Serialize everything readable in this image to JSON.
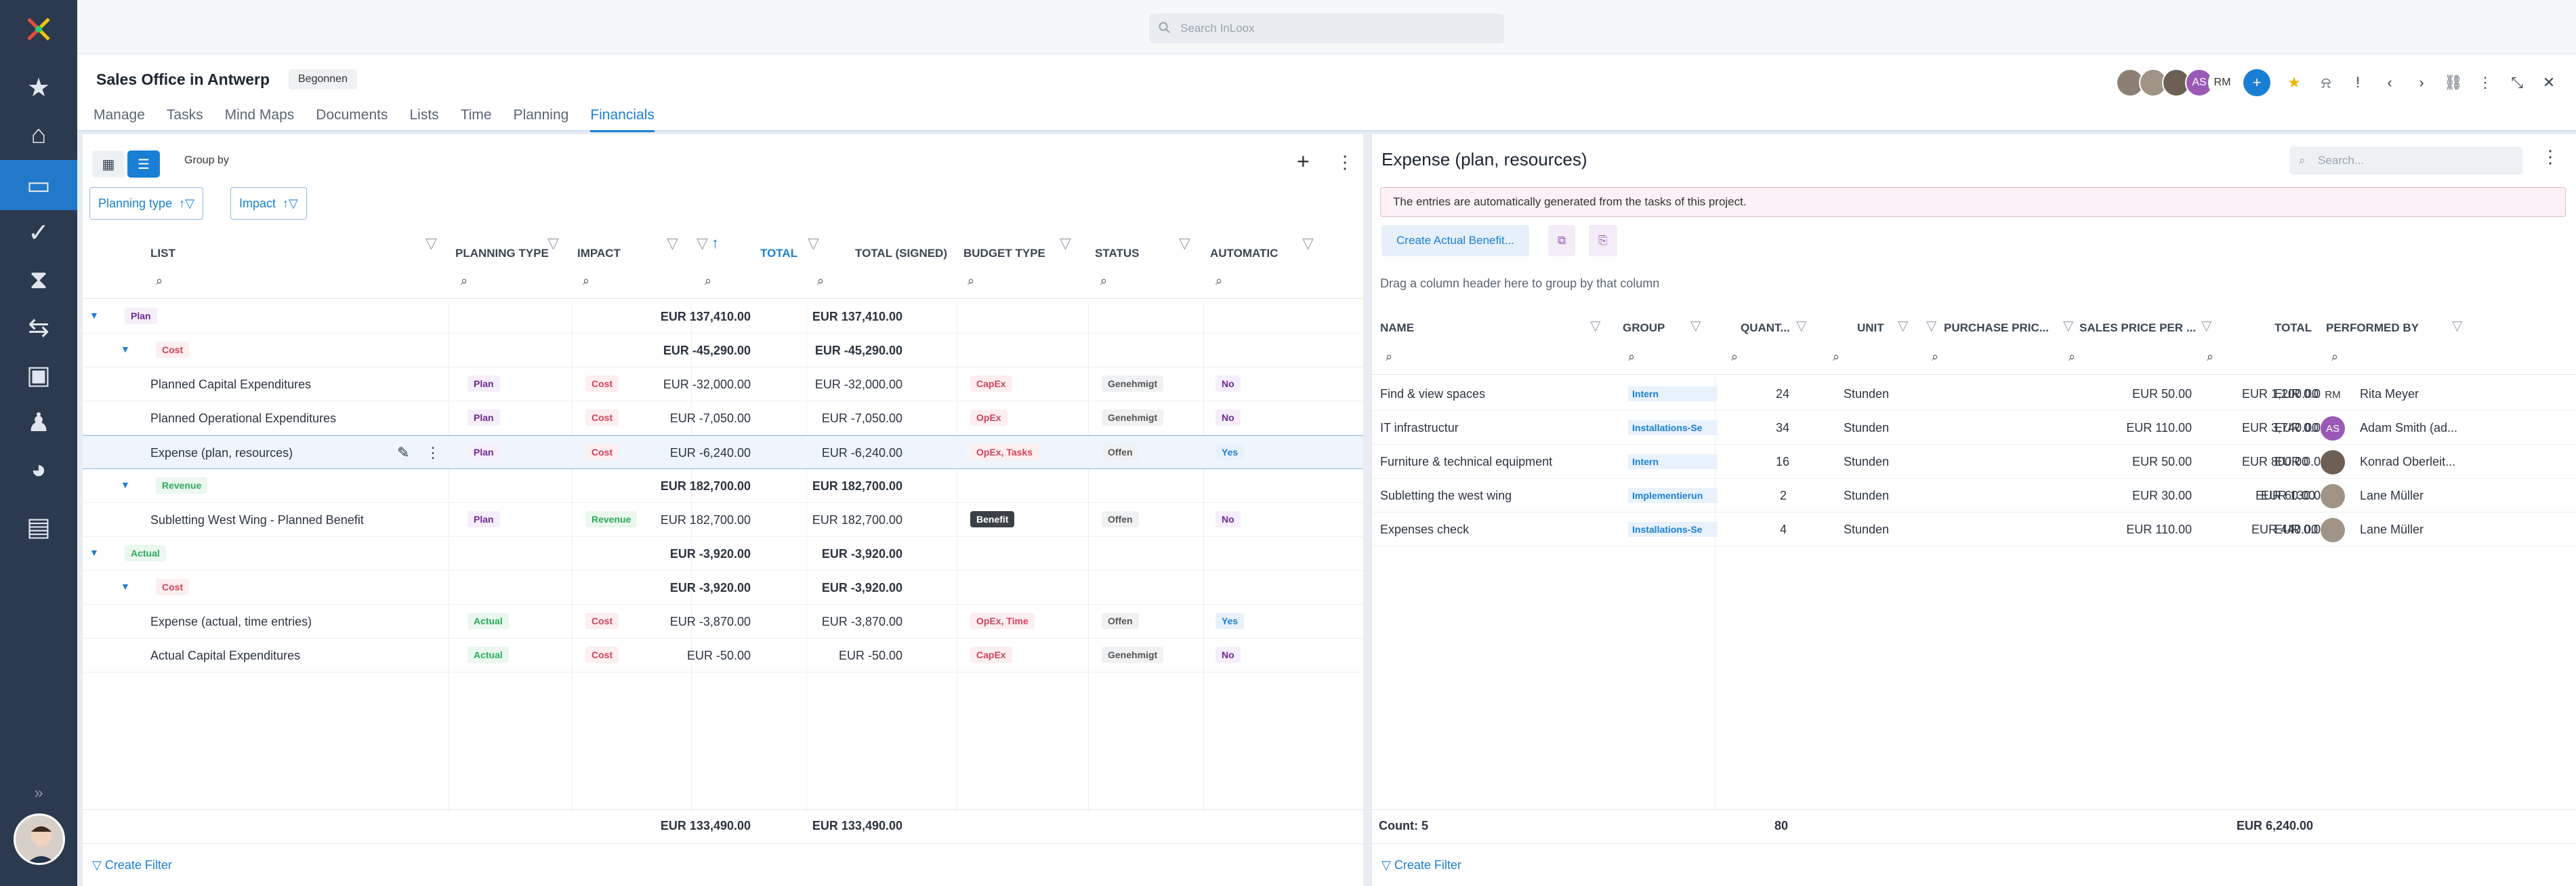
{
  "app": {
    "search_placeholder": "Search InLoox"
  },
  "colors": {
    "accent": "#1a7fd4",
    "nav_bg": "#2b3a4e"
  },
  "nav": {
    "items": [
      "star-icon",
      "home-icon",
      "projects-icon",
      "tasks-icon",
      "hourglass-icon",
      "swap-icon",
      "contacts-icon",
      "user-icon",
      "reports-icon",
      "documents-icon"
    ],
    "expand": "»"
  },
  "project": {
    "title": "Sales Office in Antwerp",
    "status": "Begonnen",
    "tabs": [
      "Manage",
      "Tasks",
      "Mind Maps",
      "Documents",
      "Lists",
      "Time",
      "Planning",
      "Financials"
    ],
    "active_tab": "Financials",
    "members": [
      {
        "initials": ""
      },
      {
        "initials": ""
      },
      {
        "initials": ""
      },
      {
        "initials": "AS"
      },
      {
        "initials": "RM"
      }
    ]
  },
  "left": {
    "group_by": "Group by",
    "chips": [
      "Planning type",
      "Impact"
    ],
    "columns": [
      "LIST",
      "PLANNING TYPE",
      "IMPACT",
      "TOTAL",
      "TOTAL (SIGNED)",
      "BUDGET TYPE",
      "STATUS",
      "AUTOMATIC"
    ],
    "groups": {
      "plan": {
        "label": "Plan",
        "total": "EUR 137,410.00",
        "signed": "EUR 137,410.00"
      },
      "plan_cost": {
        "label": "Cost",
        "total": "EUR -45,290.00",
        "signed": "EUR -45,290.00"
      },
      "plan_rev": {
        "label": "Revenue",
        "total": "EUR 182,700.00",
        "signed": "EUR 182,700.00"
      },
      "actual": {
        "label": "Actual",
        "total": "EUR -3,920.00",
        "signed": "EUR -3,920.00"
      },
      "actual_cost": {
        "label": "Cost",
        "total": "EUR -3,920.00",
        "signed": "EUR -3,920.00"
      }
    },
    "rows": [
      {
        "name": "Planned Capital Expenditures",
        "ptype": "Plan",
        "impact": "Cost",
        "total": "EUR -32,000.00",
        "signed": "EUR -32,000.00",
        "budget": "CapEx",
        "status": "Genehmigt",
        "auto": "No"
      },
      {
        "name": "Planned Operational Expenditures",
        "ptype": "Plan",
        "impact": "Cost",
        "total": "EUR -7,050.00",
        "signed": "EUR -7,050.00",
        "budget": "OpEx",
        "status": "Genehmigt",
        "auto": "No"
      },
      {
        "name": "Expense (plan, resources)",
        "ptype": "Plan",
        "impact": "Cost",
        "total": "EUR -6,240.00",
        "signed": "EUR -6,240.00",
        "budget": "OpEx, Tasks",
        "status": "Offen",
        "auto": "Yes"
      },
      {
        "name": "Subletting West Wing - Planned Benefit",
        "ptype": "Plan",
        "impact": "Revenue",
        "total": "EUR 182,700.00",
        "signed": "EUR 182,700.00",
        "budget": "Benefit",
        "status": "Offen",
        "auto": "No"
      },
      {
        "name": "Expense (actual, time entries)",
        "ptype": "Actual",
        "impact": "Cost",
        "total": "EUR -3,870.00",
        "signed": "EUR -3,870.00",
        "budget": "OpEx, Time",
        "status": "Offen",
        "auto": "Yes"
      },
      {
        "name": "Actual Capital Expenditures",
        "ptype": "Actual",
        "impact": "Cost",
        "total": "EUR -50.00",
        "signed": "EUR -50.00",
        "budget": "CapEx",
        "status": "Genehmigt",
        "auto": "No"
      }
    ],
    "footer_total": "EUR 133,490.00",
    "footer_signed": "EUR 133,490.00",
    "create_filter": "Create Filter"
  },
  "right": {
    "title": "Expense (plan, resources)",
    "search_placeholder": "Search...",
    "notice": "The entries are automatically generated from the tasks of this project.",
    "create_btn": "Create Actual Benefit...",
    "drag_hint": "Drag a column header here to group by that column",
    "columns": [
      "NAME",
      "GROUP",
      "QUANT...",
      "UNIT",
      "PURCHASE PRIC...",
      "SALES PRICE PER ...",
      "TOTAL",
      "PERFORMED BY"
    ],
    "rows": [
      {
        "name": "Find & view spaces",
        "group": "Intern",
        "qty": "24",
        "unit": "Stunden",
        "purchase": "EUR 50.00",
        "sales": "EUR 0.00",
        "total": "EUR 1,200.00",
        "by": "Rita Meyer",
        "avatar": "RM"
      },
      {
        "name": "IT infrastructur",
        "group": "Installations-Se",
        "qty": "34",
        "unit": "Stunden",
        "purchase": "EUR 110.00",
        "sales": "EUR 0.00",
        "total": "EUR 3,740.00",
        "by": "Adam Smith (ad...",
        "avatar": "AS"
      },
      {
        "name": "Furniture & technical equipment",
        "group": "Intern",
        "qty": "16",
        "unit": "Stunden",
        "purchase": "EUR 50.00",
        "sales": "EUR 0.00",
        "total": "EUR 800.00",
        "by": "Konrad Oberleit...",
        "avatar": ""
      },
      {
        "name": "Subletting the west wing",
        "group": "Implementierun",
        "qty": "2",
        "unit": "Stunden",
        "purchase": "EUR 30.00",
        "sales": "EUR 130.00",
        "total": "EUR 60.00",
        "by": "Lane Müller",
        "avatar": ""
      },
      {
        "name": "Expenses check",
        "group": "Installations-Se",
        "qty": "4",
        "unit": "Stunden",
        "purchase": "EUR 110.00",
        "sales": "EUR 0.00",
        "total": "EUR 440.00",
        "by": "Lane Müller",
        "avatar": ""
      }
    ],
    "footer_count": "Count: 5",
    "footer_qty": "80",
    "footer_total": "EUR 6,240.00",
    "create_filter": "Create Filter"
  }
}
